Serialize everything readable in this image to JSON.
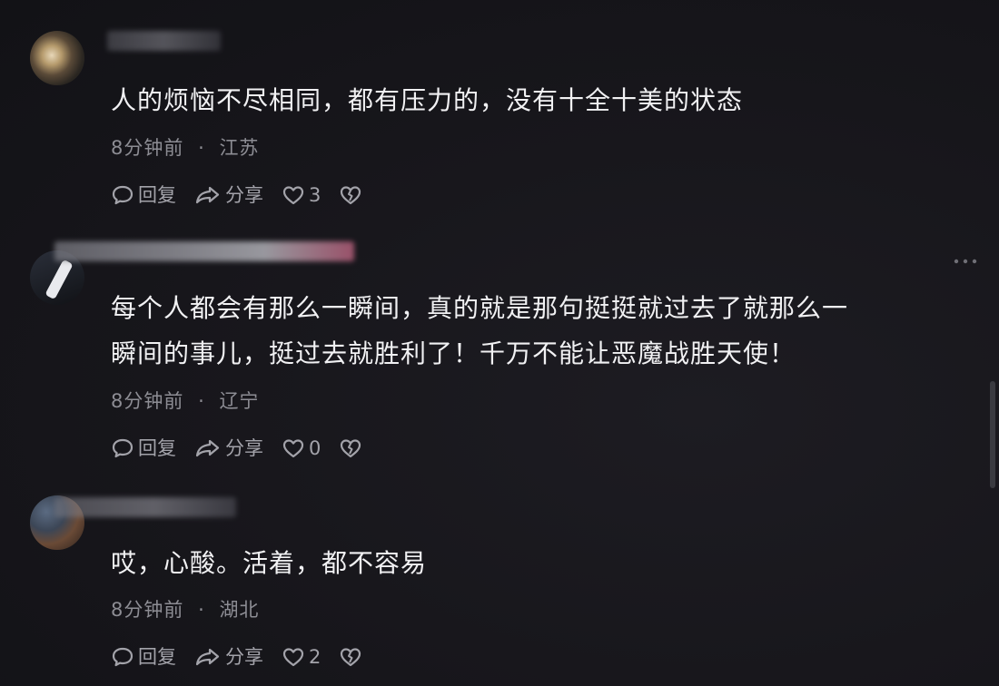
{
  "comments": [
    {
      "text": "人的烦恼不尽相同，都有压力的，没有十全十美的状态",
      "time": "8分钟前",
      "location": "江苏",
      "reply_label": "回复",
      "share_label": "分享",
      "likes": "3"
    },
    {
      "text_line1": "每个人都会有那么一瞬间，真的就是那句挺挺就过去了就那么一",
      "text_line2": "瞬间的事儿，挺过去就胜利了！千万不能让恶魔战胜天使！",
      "time": "8分钟前",
      "location": "辽宁",
      "reply_label": "回复",
      "share_label": "分享",
      "likes": "0"
    },
    {
      "text": "哎，心酸。活着，都不容易",
      "time": "8分钟前",
      "location": "湖北",
      "reply_label": "回复",
      "share_label": "分享",
      "likes": "2"
    }
  ],
  "separator": "·",
  "icons": {
    "reply": "comment-bubble-icon",
    "share": "share-arrow-icon",
    "like": "heart-outline-icon",
    "dislike": "broken-heart-icon",
    "more": "more-dots-icon"
  },
  "colors": {
    "background": "#16161b",
    "text": "#f1f1f3",
    "meta": "#8d8d94",
    "action": "#a3a3aa"
  }
}
